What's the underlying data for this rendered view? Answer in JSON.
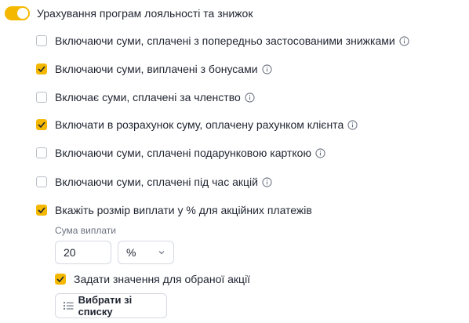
{
  "toggle": {
    "label": "Урахування програм лояльності та знижок",
    "on": true
  },
  "options": [
    {
      "label": "Включаючи суми, сплачені з попередньо застосованими знижками",
      "checked": false,
      "info": true
    },
    {
      "label": "Включаючи суми, виплачені з бонусами",
      "checked": true,
      "info": true
    },
    {
      "label": "Включає суми, сплачені за членство",
      "checked": false,
      "info": true
    },
    {
      "label": "Включати в розрахунок суму, оплачену рахунком клієнта",
      "checked": true,
      "info": true
    },
    {
      "label": "Включаючи суми, сплачені подарунковою карткою",
      "checked": false,
      "info": true
    },
    {
      "label": "Включаючи суми, сплачені під час акцій",
      "checked": false,
      "info": true
    },
    {
      "label": "Вкажіть розмір виплати у % для акційних платежів",
      "checked": true,
      "info": false
    }
  ],
  "payout": {
    "label": "Сума виплати",
    "value": "20",
    "unit": "%"
  },
  "sub_option": {
    "label": "Задати значення для обраної акції",
    "checked": true
  },
  "select_button": {
    "label": "Вибрати зі списку"
  },
  "colors": {
    "accent": "#f5b800",
    "border": "#d5d9e0"
  }
}
